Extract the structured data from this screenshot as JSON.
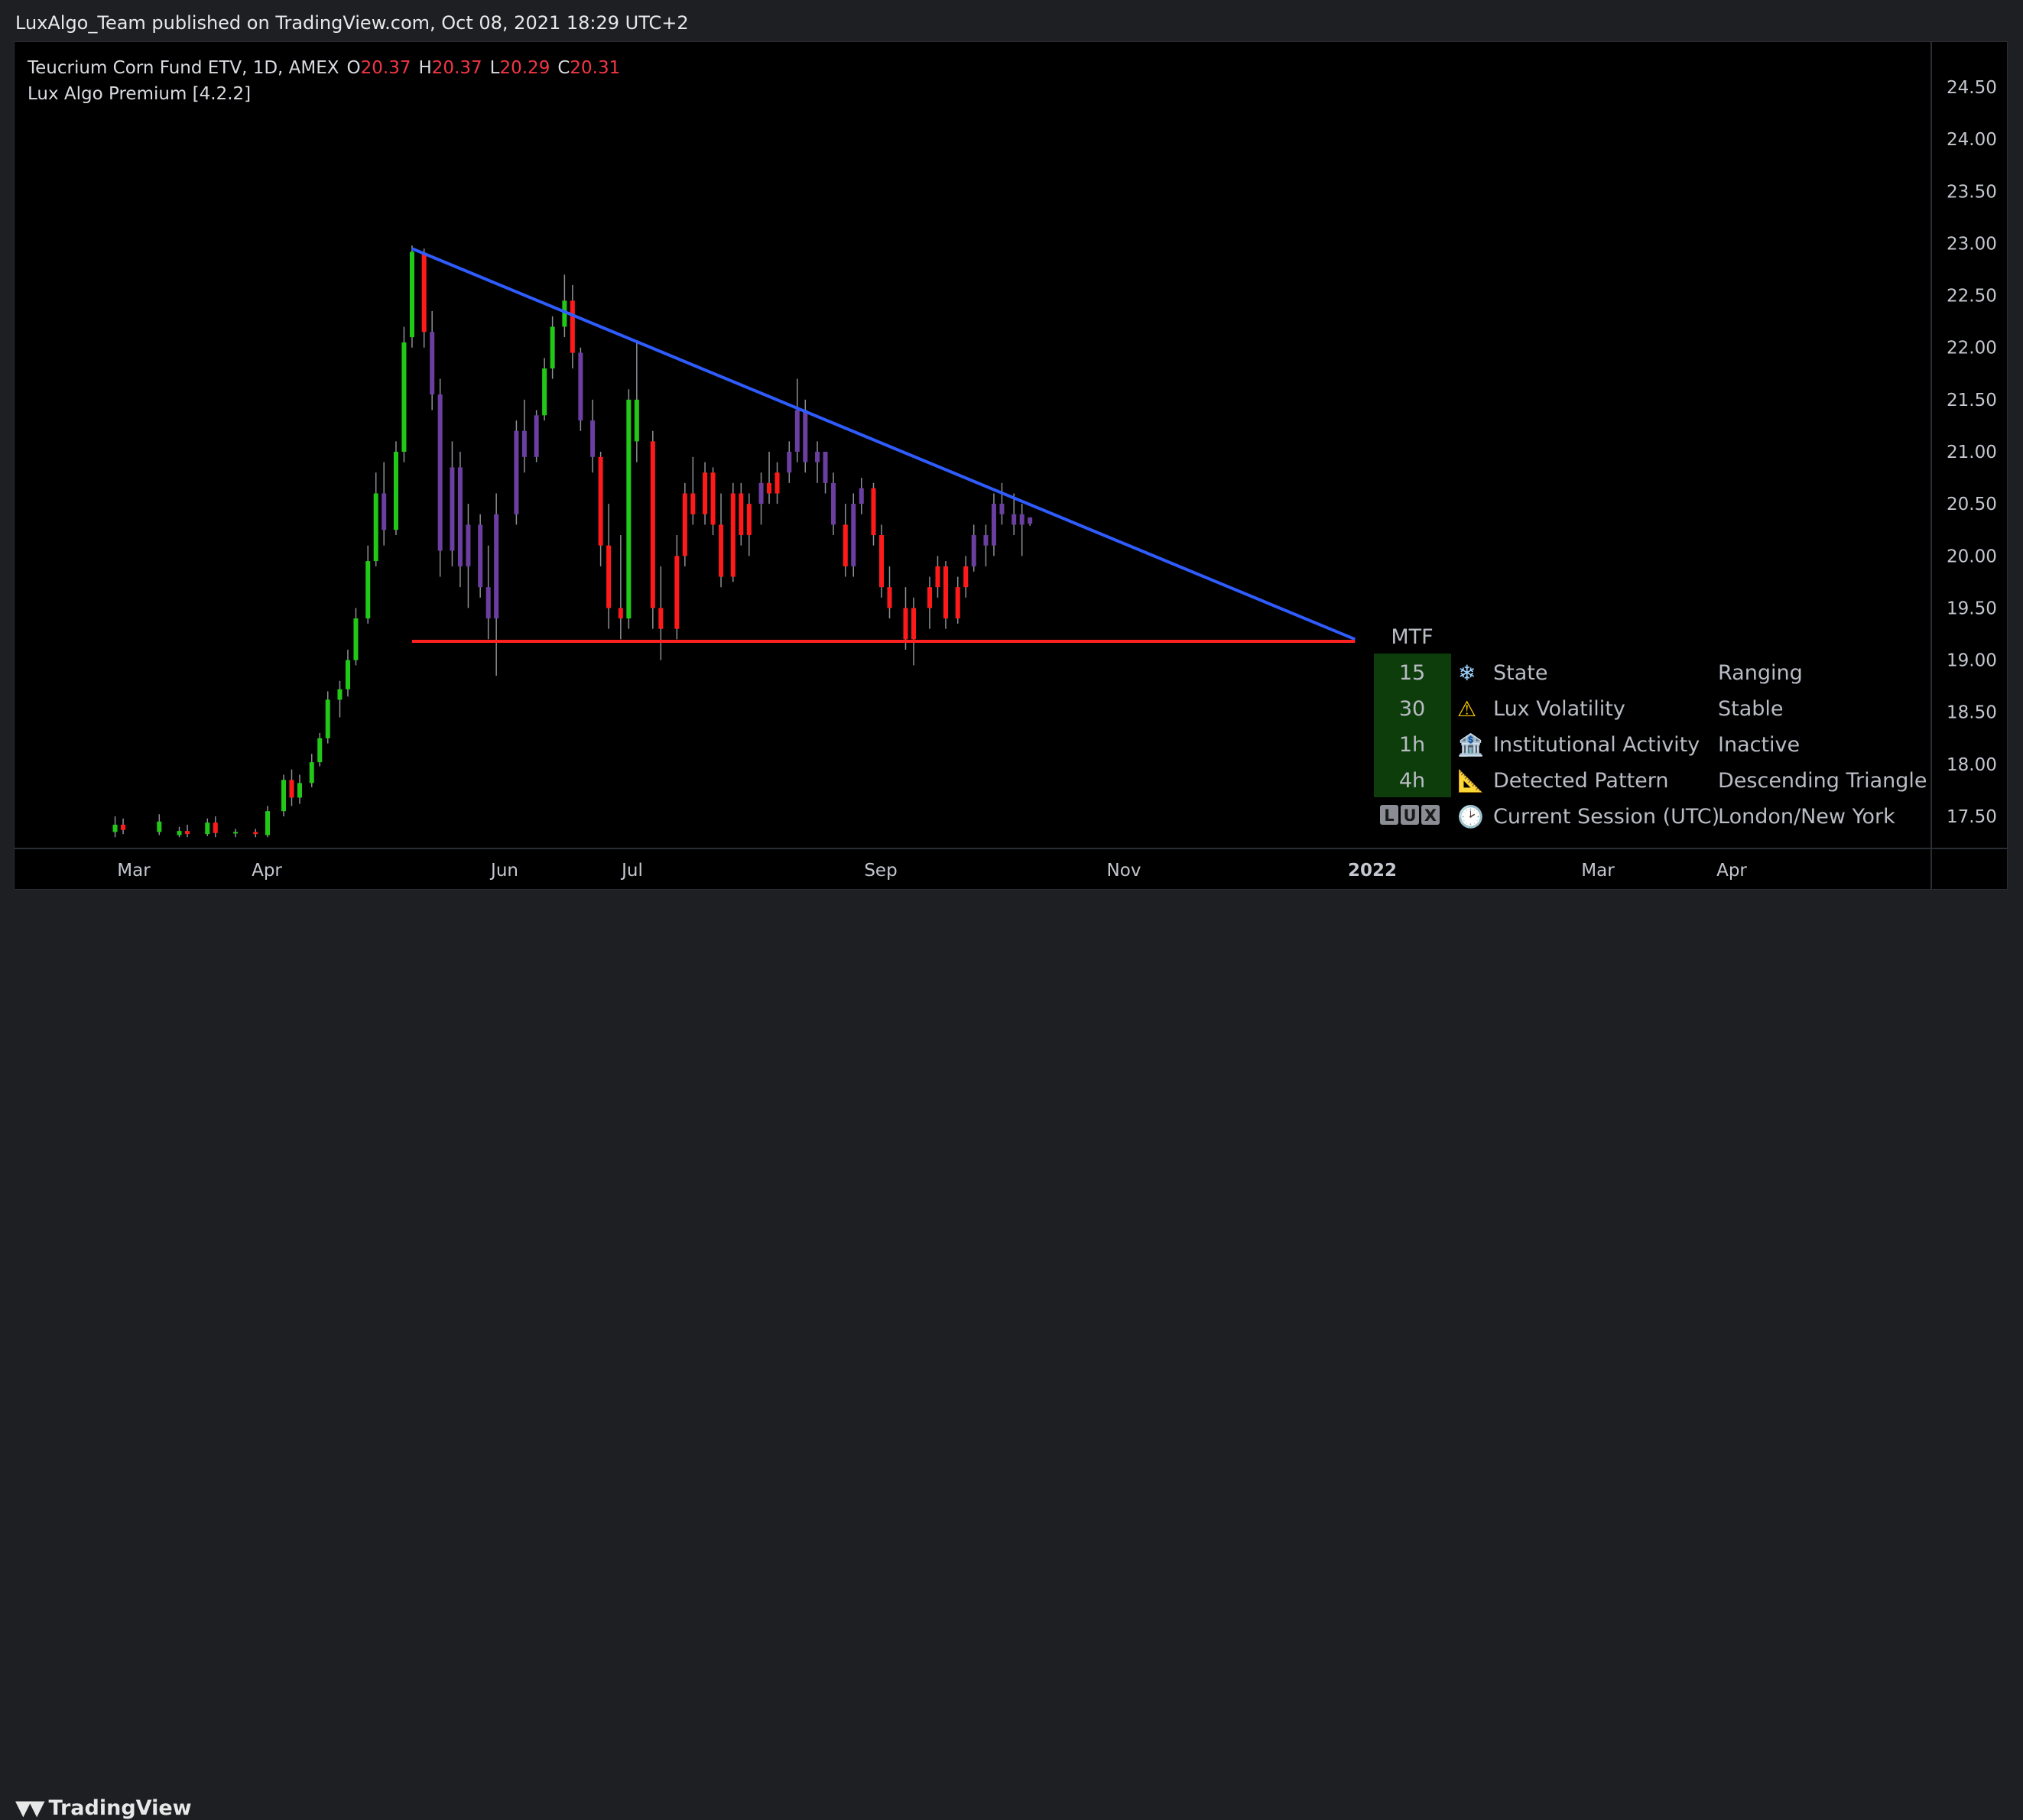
{
  "header": {
    "publisher_line": "LuxAlgo_Team published on TradingView.com, Oct 08, 2021 18:29 UTC+2"
  },
  "legend": {
    "symbol_line": "Teucrium Corn Fund ETV, 1D, AMEX",
    "o_label": "O",
    "o_value": "20.37",
    "h_label": "H",
    "h_value": "20.37",
    "l_label": "L",
    "l_value": "20.29",
    "c_label": "C",
    "c_value": "20.31",
    "indicator": "Lux Algo Premium [4.2.2]"
  },
  "footer": {
    "brand": "TradingView"
  },
  "colors": {
    "bull": "#22c818",
    "bear": "#ff1a1a",
    "neutral": "#6a3fa0",
    "trendline": "#2f5cff",
    "support": "#ff2020",
    "table_bg": "#0e3d0c"
  },
  "mtf_table": {
    "header": "MTF",
    "logo_letters": [
      "L",
      "U",
      "X"
    ],
    "rows": [
      {
        "tf": "15",
        "icon": "snowflake-icon",
        "glyph": "❄",
        "label": "State",
        "value": "Ranging"
      },
      {
        "tf": "30",
        "icon": "warning-icon",
        "glyph": "⚠",
        "label": "Lux Volatility",
        "value": "Stable"
      },
      {
        "tf": "1h",
        "icon": "bank-icon",
        "glyph": "🏦",
        "label": "Institutional Activity",
        "value": "Inactive"
      },
      {
        "tf": "4h",
        "icon": "triangle-ruler-icon",
        "glyph": "📐",
        "label": "Detected Pattern",
        "value": "Descending Triangle"
      },
      {
        "tf": "",
        "icon": "clock-icon",
        "glyph": "🕑",
        "label": "Current Session (UTC)",
        "value": "London/New York"
      }
    ]
  },
  "chart_data": {
    "type": "candlestick",
    "ylim": [
      17.3,
      24.7
    ],
    "y_ticks": [
      "24.50",
      "24.00",
      "23.50",
      "23.00",
      "22.50",
      "22.00",
      "21.50",
      "21.00",
      "20.50",
      "20.00",
      "19.50",
      "19.00",
      "18.50",
      "18.00",
      "17.50"
    ],
    "x_ticks": [
      "Mar",
      "Apr",
      "Jun",
      "Jul",
      "Sep",
      "Nov",
      "2022",
      "Mar",
      "Apr"
    ],
    "trendline": {
      "from": {
        "date": "2021-05-07",
        "price": 22.95
      },
      "to": {
        "date": "2021-12-28",
        "price": 19.2
      }
    },
    "support": {
      "from": {
        "date": "2021-05-07",
        "price": 19.18
      },
      "to": {
        "date": "2021-12-28",
        "price": 19.18
      }
    },
    "candles": [
      {
        "d": "2021-02-22",
        "o": 17.35,
        "h": 17.5,
        "l": 17.3,
        "c": 17.42,
        "t": "bull"
      },
      {
        "d": "2021-02-24",
        "o": 17.42,
        "h": 17.48,
        "l": 17.33,
        "c": 17.37,
        "t": "bear"
      },
      {
        "d": "2021-03-05",
        "o": 17.35,
        "h": 17.52,
        "l": 17.32,
        "c": 17.45,
        "t": "bull"
      },
      {
        "d": "2021-03-10",
        "o": 17.32,
        "h": 17.4,
        "l": 17.3,
        "c": 17.36,
        "t": "bull"
      },
      {
        "d": "2021-03-12",
        "o": 17.36,
        "h": 17.42,
        "l": 17.3,
        "c": 17.33,
        "t": "bear"
      },
      {
        "d": "2021-03-17",
        "o": 17.33,
        "h": 17.48,
        "l": 17.31,
        "c": 17.44,
        "t": "bull"
      },
      {
        "d": "2021-03-19",
        "o": 17.44,
        "h": 17.5,
        "l": 17.3,
        "c": 17.34,
        "t": "bear"
      },
      {
        "d": "2021-03-24",
        "o": 17.34,
        "h": 17.38,
        "l": 17.3,
        "c": 17.35,
        "t": "bull"
      },
      {
        "d": "2021-03-29",
        "o": 17.35,
        "h": 17.38,
        "l": 17.3,
        "c": 17.33,
        "t": "bear"
      },
      {
        "d": "2021-04-01",
        "o": 17.32,
        "h": 17.6,
        "l": 17.3,
        "c": 17.55,
        "t": "bull"
      },
      {
        "d": "2021-04-05",
        "o": 17.55,
        "h": 17.9,
        "l": 17.5,
        "c": 17.85,
        "t": "bull"
      },
      {
        "d": "2021-04-07",
        "o": 17.85,
        "h": 17.95,
        "l": 17.6,
        "c": 17.68,
        "t": "bear"
      },
      {
        "d": "2021-04-09",
        "o": 17.68,
        "h": 17.9,
        "l": 17.62,
        "c": 17.82,
        "t": "bull"
      },
      {
        "d": "2021-04-12",
        "o": 17.82,
        "h": 18.1,
        "l": 17.78,
        "c": 18.02,
        "t": "bull"
      },
      {
        "d": "2021-04-14",
        "o": 18.02,
        "h": 18.3,
        "l": 17.98,
        "c": 18.25,
        "t": "bull"
      },
      {
        "d": "2021-04-16",
        "o": 18.25,
        "h": 18.7,
        "l": 18.2,
        "c": 18.62,
        "t": "bull"
      },
      {
        "d": "2021-04-19",
        "o": 18.62,
        "h": 18.8,
        "l": 18.45,
        "c": 18.72,
        "t": "bull"
      },
      {
        "d": "2021-04-21",
        "o": 18.72,
        "h": 19.1,
        "l": 18.65,
        "c": 19.0,
        "t": "bull"
      },
      {
        "d": "2021-04-23",
        "o": 19.0,
        "h": 19.5,
        "l": 18.95,
        "c": 19.4,
        "t": "bull"
      },
      {
        "d": "2021-04-26",
        "o": 19.4,
        "h": 20.1,
        "l": 19.35,
        "c": 19.95,
        "t": "bull"
      },
      {
        "d": "2021-04-28",
        "o": 19.95,
        "h": 20.8,
        "l": 19.9,
        "c": 20.6,
        "t": "bull"
      },
      {
        "d": "2021-04-30",
        "o": 20.6,
        "h": 20.9,
        "l": 20.1,
        "c": 20.25,
        "t": "neutral"
      },
      {
        "d": "2021-05-03",
        "o": 20.25,
        "h": 21.1,
        "l": 20.2,
        "c": 21.0,
        "t": "bull"
      },
      {
        "d": "2021-05-05",
        "o": 21.0,
        "h": 22.2,
        "l": 20.9,
        "c": 22.05,
        "t": "bull"
      },
      {
        "d": "2021-05-07",
        "o": 22.1,
        "h": 22.98,
        "l": 22.0,
        "c": 22.92,
        "t": "bull"
      },
      {
        "d": "2021-05-10",
        "o": 22.9,
        "h": 22.95,
        "l": 22.0,
        "c": 22.15,
        "t": "bear"
      },
      {
        "d": "2021-05-12",
        "o": 22.15,
        "h": 22.35,
        "l": 21.4,
        "c": 21.55,
        "t": "neutral"
      },
      {
        "d": "2021-05-14",
        "o": 21.55,
        "h": 21.7,
        "l": 19.8,
        "c": 20.05,
        "t": "neutral"
      },
      {
        "d": "2021-05-17",
        "o": 20.05,
        "h": 21.1,
        "l": 19.9,
        "c": 20.85,
        "t": "neutral"
      },
      {
        "d": "2021-05-19",
        "o": 20.85,
        "h": 21.0,
        "l": 19.7,
        "c": 19.9,
        "t": "neutral"
      },
      {
        "d": "2021-05-21",
        "o": 19.9,
        "h": 20.5,
        "l": 19.5,
        "c": 20.3,
        "t": "neutral"
      },
      {
        "d": "2021-05-24",
        "o": 20.3,
        "h": 20.4,
        "l": 19.6,
        "c": 19.7,
        "t": "neutral"
      },
      {
        "d": "2021-05-26",
        "o": 19.7,
        "h": 20.1,
        "l": 19.2,
        "c": 19.4,
        "t": "neutral"
      },
      {
        "d": "2021-05-28",
        "o": 19.4,
        "h": 20.6,
        "l": 18.85,
        "c": 20.4,
        "t": "neutral"
      },
      {
        "d": "2021-06-02",
        "o": 20.4,
        "h": 21.3,
        "l": 20.3,
        "c": 21.2,
        "t": "neutral"
      },
      {
        "d": "2021-06-04",
        "o": 21.2,
        "h": 21.5,
        "l": 20.8,
        "c": 20.95,
        "t": "neutral"
      },
      {
        "d": "2021-06-07",
        "o": 20.95,
        "h": 21.4,
        "l": 20.9,
        "c": 21.35,
        "t": "neutral"
      },
      {
        "d": "2021-06-09",
        "o": 21.35,
        "h": 21.9,
        "l": 21.3,
        "c": 21.8,
        "t": "bull"
      },
      {
        "d": "2021-06-11",
        "o": 21.8,
        "h": 22.3,
        "l": 21.7,
        "c": 22.2,
        "t": "bull"
      },
      {
        "d": "2021-06-14",
        "o": 22.2,
        "h": 22.7,
        "l": 22.1,
        "c": 22.45,
        "t": "bull"
      },
      {
        "d": "2021-06-16",
        "o": 22.45,
        "h": 22.6,
        "l": 21.8,
        "c": 21.95,
        "t": "bear"
      },
      {
        "d": "2021-06-18",
        "o": 21.95,
        "h": 22.0,
        "l": 21.2,
        "c": 21.3,
        "t": "neutral"
      },
      {
        "d": "2021-06-21",
        "o": 21.3,
        "h": 21.5,
        "l": 20.8,
        "c": 20.95,
        "t": "neutral"
      },
      {
        "d": "2021-06-23",
        "o": 20.95,
        "h": 21.0,
        "l": 19.9,
        "c": 20.1,
        "t": "bear"
      },
      {
        "d": "2021-06-25",
        "o": 20.1,
        "h": 20.5,
        "l": 19.3,
        "c": 19.5,
        "t": "bear"
      },
      {
        "d": "2021-06-28",
        "o": 19.5,
        "h": 20.2,
        "l": 19.2,
        "c": 19.4,
        "t": "bear"
      },
      {
        "d": "2021-06-30",
        "o": 19.4,
        "h": 21.6,
        "l": 19.3,
        "c": 21.5,
        "t": "bull"
      },
      {
        "d": "2021-07-02",
        "o": 21.5,
        "h": 22.05,
        "l": 20.9,
        "c": 21.1,
        "t": "bull"
      },
      {
        "d": "2021-07-06",
        "o": 21.1,
        "h": 21.2,
        "l": 19.3,
        "c": 19.5,
        "t": "bear"
      },
      {
        "d": "2021-07-08",
        "o": 19.5,
        "h": 19.9,
        "l": 19.0,
        "c": 19.3,
        "t": "bear"
      },
      {
        "d": "2021-07-12",
        "o": 19.3,
        "h": 20.2,
        "l": 19.2,
        "c": 20.0,
        "t": "bear"
      },
      {
        "d": "2021-07-14",
        "o": 20.0,
        "h": 20.7,
        "l": 19.9,
        "c": 20.6,
        "t": "bear"
      },
      {
        "d": "2021-07-16",
        "o": 20.6,
        "h": 20.95,
        "l": 20.3,
        "c": 20.4,
        "t": "bear"
      },
      {
        "d": "2021-07-19",
        "o": 20.4,
        "h": 20.9,
        "l": 20.3,
        "c": 20.8,
        "t": "bear"
      },
      {
        "d": "2021-07-21",
        "o": 20.8,
        "h": 20.85,
        "l": 20.2,
        "c": 20.3,
        "t": "bear"
      },
      {
        "d": "2021-07-23",
        "o": 20.3,
        "h": 20.6,
        "l": 19.7,
        "c": 19.8,
        "t": "bear"
      },
      {
        "d": "2021-07-26",
        "o": 19.8,
        "h": 20.7,
        "l": 19.75,
        "c": 20.6,
        "t": "bear"
      },
      {
        "d": "2021-07-28",
        "o": 20.6,
        "h": 20.7,
        "l": 20.1,
        "c": 20.2,
        "t": "bear"
      },
      {
        "d": "2021-07-30",
        "o": 20.2,
        "h": 20.6,
        "l": 20.0,
        "c": 20.5,
        "t": "bear"
      },
      {
        "d": "2021-08-02",
        "o": 20.5,
        "h": 20.8,
        "l": 20.3,
        "c": 20.7,
        "t": "neutral"
      },
      {
        "d": "2021-08-04",
        "o": 20.7,
        "h": 21.0,
        "l": 20.5,
        "c": 20.6,
        "t": "bear"
      },
      {
        "d": "2021-08-06",
        "o": 20.6,
        "h": 20.9,
        "l": 20.5,
        "c": 20.8,
        "t": "bear"
      },
      {
        "d": "2021-08-09",
        "o": 20.8,
        "h": 21.1,
        "l": 20.7,
        "c": 21.0,
        "t": "neutral"
      },
      {
        "d": "2021-08-11",
        "o": 21.0,
        "h": 21.7,
        "l": 20.9,
        "c": 21.4,
        "t": "neutral"
      },
      {
        "d": "2021-08-13",
        "o": 21.4,
        "h": 21.5,
        "l": 20.8,
        "c": 20.9,
        "t": "neutral"
      },
      {
        "d": "2021-08-16",
        "o": 20.9,
        "h": 21.1,
        "l": 20.7,
        "c": 21.0,
        "t": "neutral"
      },
      {
        "d": "2021-08-18",
        "o": 21.0,
        "h": 21.0,
        "l": 20.6,
        "c": 20.7,
        "t": "neutral"
      },
      {
        "d": "2021-08-20",
        "o": 20.7,
        "h": 20.8,
        "l": 20.2,
        "c": 20.3,
        "t": "neutral"
      },
      {
        "d": "2021-08-23",
        "o": 20.3,
        "h": 20.5,
        "l": 19.8,
        "c": 19.9,
        "t": "bear"
      },
      {
        "d": "2021-08-25",
        "o": 19.9,
        "h": 20.6,
        "l": 19.8,
        "c": 20.5,
        "t": "neutral"
      },
      {
        "d": "2021-08-27",
        "o": 20.5,
        "h": 20.75,
        "l": 20.4,
        "c": 20.65,
        "t": "neutral"
      },
      {
        "d": "2021-08-30",
        "o": 20.65,
        "h": 20.7,
        "l": 20.1,
        "c": 20.2,
        "t": "bear"
      },
      {
        "d": "2021-09-01",
        "o": 20.2,
        "h": 20.3,
        "l": 19.6,
        "c": 19.7,
        "t": "bear"
      },
      {
        "d": "2021-09-03",
        "o": 19.7,
        "h": 19.9,
        "l": 19.4,
        "c": 19.5,
        "t": "bear"
      },
      {
        "d": "2021-09-07",
        "o": 19.5,
        "h": 19.7,
        "l": 19.1,
        "c": 19.2,
        "t": "bear"
      },
      {
        "d": "2021-09-09",
        "o": 19.2,
        "h": 19.6,
        "l": 18.95,
        "c": 19.5,
        "t": "bear"
      },
      {
        "d": "2021-09-13",
        "o": 19.5,
        "h": 19.8,
        "l": 19.3,
        "c": 19.7,
        "t": "bear"
      },
      {
        "d": "2021-09-15",
        "o": 19.7,
        "h": 20.0,
        "l": 19.6,
        "c": 19.9,
        "t": "bear"
      },
      {
        "d": "2021-09-17",
        "o": 19.9,
        "h": 19.95,
        "l": 19.3,
        "c": 19.4,
        "t": "bear"
      },
      {
        "d": "2021-09-20",
        "o": 19.4,
        "h": 19.8,
        "l": 19.35,
        "c": 19.7,
        "t": "bear"
      },
      {
        "d": "2021-09-22",
        "o": 19.7,
        "h": 20.0,
        "l": 19.6,
        "c": 19.9,
        "t": "bear"
      },
      {
        "d": "2021-09-24",
        "o": 19.9,
        "h": 20.3,
        "l": 19.85,
        "c": 20.2,
        "t": "neutral"
      },
      {
        "d": "2021-09-27",
        "o": 20.2,
        "h": 20.3,
        "l": 19.9,
        "c": 20.1,
        "t": "neutral"
      },
      {
        "d": "2021-09-29",
        "o": 20.1,
        "h": 20.6,
        "l": 20.0,
        "c": 20.5,
        "t": "neutral"
      },
      {
        "d": "2021-10-01",
        "o": 20.5,
        "h": 20.7,
        "l": 20.3,
        "c": 20.4,
        "t": "neutral"
      },
      {
        "d": "2021-10-04",
        "o": 20.4,
        "h": 20.6,
        "l": 20.2,
        "c": 20.3,
        "t": "neutral"
      },
      {
        "d": "2021-10-06",
        "o": 20.3,
        "h": 20.5,
        "l": 20.0,
        "c": 20.4,
        "t": "neutral"
      },
      {
        "d": "2021-10-08",
        "o": 20.37,
        "h": 20.37,
        "l": 20.29,
        "c": 20.31,
        "t": "neutral"
      }
    ]
  }
}
